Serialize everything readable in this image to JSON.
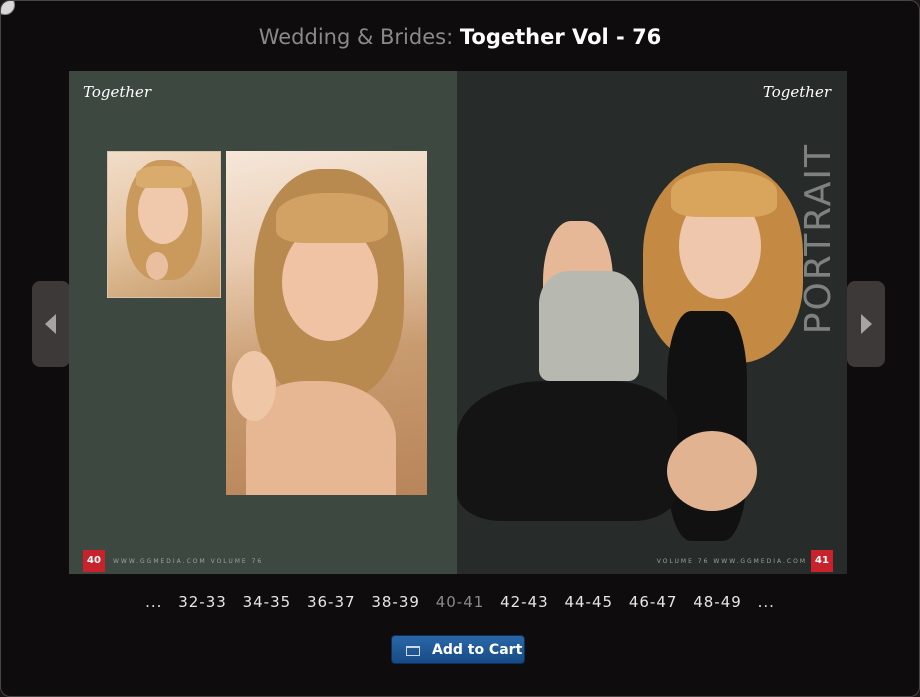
{
  "header": {
    "category": "Wedding & Brides:",
    "title": "Together Vol - 76"
  },
  "spread": {
    "left_page": {
      "brand": "Together",
      "page_number": "40",
      "footer": "WWW.GGMEDIA.COM   VOLUME 76"
    },
    "right_page": {
      "brand": "Together",
      "page_number": "41",
      "section_word": "PORTRAIT",
      "footer": "VOLUME 76   WWW.GGMEDIA.COM"
    }
  },
  "pagination": {
    "prev_ellipsis": "...",
    "items": [
      "32-33",
      "34-35",
      "36-37",
      "38-39",
      "40-41",
      "42-43",
      "44-45",
      "46-47",
      "48-49"
    ],
    "current": "40-41",
    "next_ellipsis": "..."
  },
  "cart": {
    "label": "Add to Cart",
    "icon": "cart-icon"
  },
  "icons": {
    "prev": "chevron-left-icon",
    "next": "chevron-right-icon",
    "close": "close-icon"
  },
  "colors": {
    "badge": "#c8232c",
    "button": "#1f5896",
    "left_page_bg": "#3c4840"
  }
}
